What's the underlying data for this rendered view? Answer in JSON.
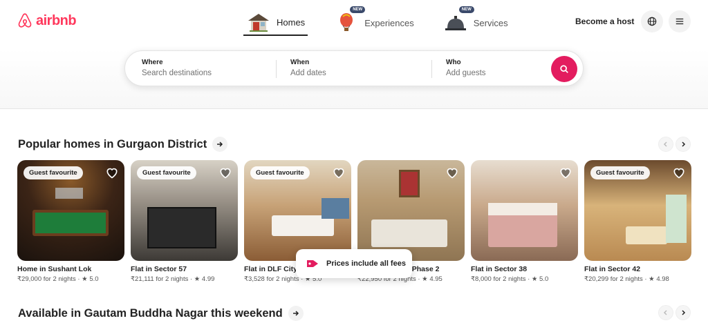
{
  "brand": {
    "name": "airbnb",
    "color": "#ff385c"
  },
  "nav": {
    "items": [
      {
        "label": "Homes",
        "icon": "house-icon",
        "active": true,
        "badge": ""
      },
      {
        "label": "Experiences",
        "icon": "hot-air-balloon-icon",
        "active": false,
        "badge": "NEW"
      },
      {
        "label": "Services",
        "icon": "service-bell-icon",
        "active": false,
        "badge": "NEW"
      }
    ]
  },
  "header": {
    "become_host": "Become a host",
    "globe_icon": "globe-icon",
    "menu_icon": "menu-icon"
  },
  "search": {
    "where_label": "Where",
    "where_placeholder": "Search destinations",
    "when_label": "When",
    "when_placeholder": "Add dates",
    "who_label": "Who",
    "who_placeholder": "Add guests",
    "button_icon": "search-icon",
    "accent": "#e31c5f"
  },
  "sections": [
    {
      "title": "Popular homes in Gurgaon District",
      "listings": [
        {
          "badge": "Guest favourite",
          "title": "Home in Sushant Lok",
          "meta": "₹29,000 for 2 nights · ★ 5.0"
        },
        {
          "badge": "Guest favourite",
          "title": "Flat in Sector 57",
          "meta": "₹21,111 for 2 nights · ★ 4.99"
        },
        {
          "badge": "Guest favourite",
          "title": "Flat in DLF City",
          "meta": "₹3,528 for 2 nights · ★ 5.0"
        },
        {
          "badge": "",
          "title": "y Phase 2",
          "meta": "₹22,950 for 2 nights · ★ 4.95"
        },
        {
          "badge": "",
          "title": "Flat in Sector 38",
          "meta": "₹8,000 for 2 nights · ★ 5.0"
        },
        {
          "badge": "Guest favourite",
          "title": "Flat in Sector 42",
          "meta": "₹20,299 for 2 nights · ★ 4.98"
        }
      ]
    },
    {
      "title": "Available in Gautam Buddha Nagar this weekend",
      "listings": []
    }
  ],
  "toast": {
    "text": "Prices include all fees",
    "icon": "price-tag-icon"
  }
}
